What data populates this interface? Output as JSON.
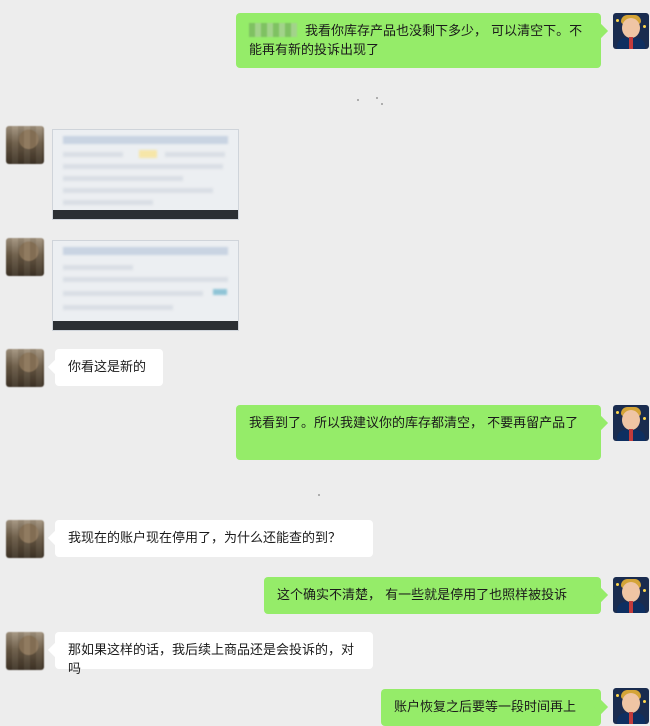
{
  "messages": [
    {
      "side": "out",
      "text": "我看你库存产品也没剩下多少， 可以清空下。不能再有新的投诉出现了",
      "redacted_name": true
    },
    {
      "side": "in",
      "type": "image"
    },
    {
      "side": "in",
      "type": "image"
    },
    {
      "side": "in",
      "text": "你看这是新的"
    },
    {
      "side": "out",
      "text": "我看到了。所以我建议你的库存都清空， 不要再留产品了"
    },
    {
      "side": "in",
      "text": "我现在的账户现在停用了，为什么还能查的到？"
    },
    {
      "side": "out",
      "text": "这个确实不清楚， 有一些就是停用了也照样被投诉"
    },
    {
      "side": "in",
      "text": "那如果这样的话，我后续上商品还是会投诉的，对吗"
    },
    {
      "side": "out",
      "text": "账户恢复之后要等一段时间再上"
    }
  ],
  "colors": {
    "background": "#ededed",
    "outgoing_bubble": "#95ec69",
    "incoming_bubble": "#ffffff"
  },
  "icons": {
    "self_avatar": "cartoon-man-avatar",
    "contact_avatar": "blurred-avatar"
  }
}
